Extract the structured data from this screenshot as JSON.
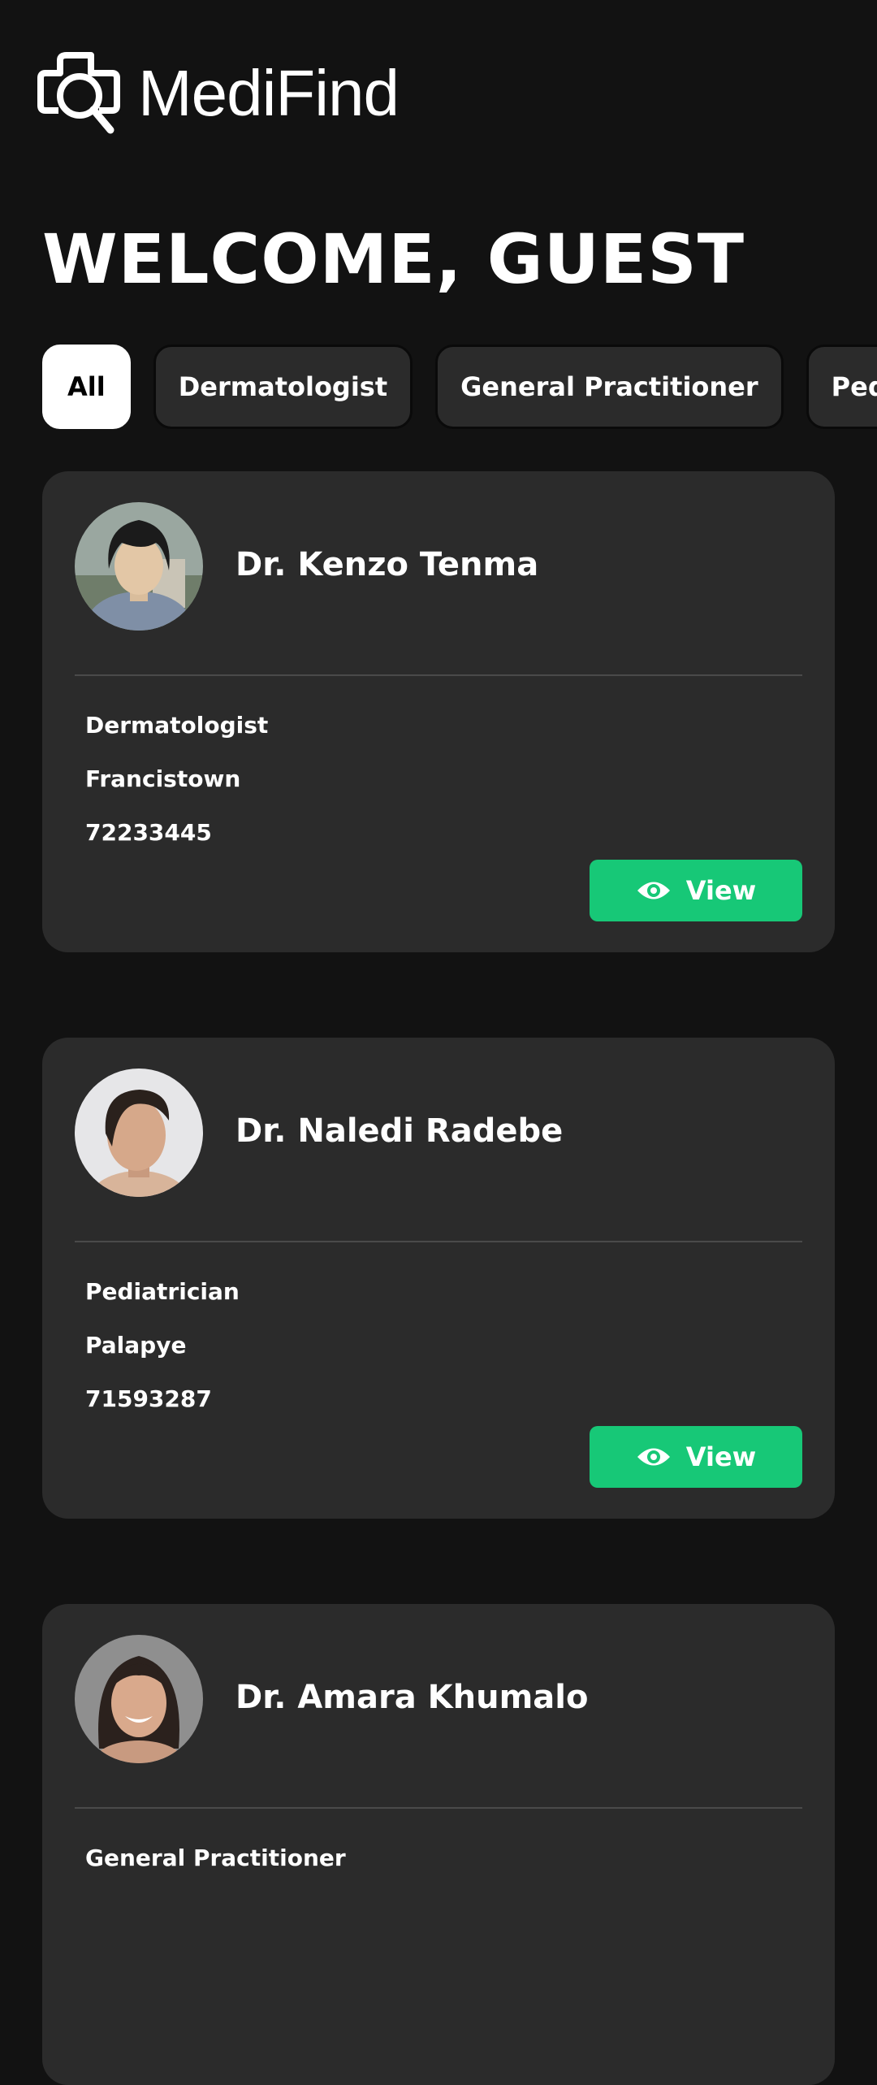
{
  "app": {
    "name": "MediFind"
  },
  "header": {
    "welcome": "WELCOME, GUEST"
  },
  "filters": {
    "chips": [
      "All",
      "Dermatologist",
      "General Practitioner",
      "Pediatrician"
    ],
    "selected": "All"
  },
  "doctors": [
    {
      "name": "Dr. Kenzo Tenma",
      "specialty": "Dermatologist",
      "location": "Francistown",
      "phone": "72233445",
      "action": "View"
    },
    {
      "name": "Dr. Naledi Radebe",
      "specialty": "Pediatrician",
      "location": "Palapye",
      "phone": "71593287",
      "action": "View"
    },
    {
      "name": "Dr. Amara Khumalo",
      "specialty": "General Practitioner"
    }
  ],
  "colors": {
    "background": "#121212",
    "card": "#2b2b2b",
    "accent": "#17c877",
    "chip_active": "#ffffff"
  },
  "icons": {
    "logo": "magnifier-cross-logo-icon",
    "view": "eye-icon"
  }
}
